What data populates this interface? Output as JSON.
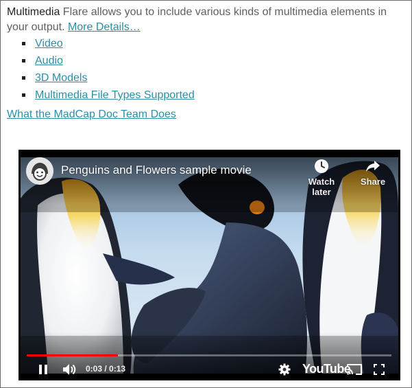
{
  "intro": {
    "term": "Multimedia",
    "text": " Flare allows you to include various kinds of multimedia elements in your output. ",
    "more_link": "More Details…"
  },
  "links": [
    {
      "label": "Video"
    },
    {
      "label": "Audio"
    },
    {
      "label": "3D Models"
    },
    {
      "label": "Multimedia File Types Supported"
    }
  ],
  "team_link": "What the MadCap Doc Team Does",
  "player": {
    "title": "Penguins and Flowers sample movie",
    "watch_later": "Watch later",
    "share": "Share",
    "current_time": "0:03",
    "duration": "0:13",
    "time_separator": " / ",
    "progress_fraction": 0.25,
    "logo_text": "YouTube",
    "accent_color": "#ff0000",
    "icons": [
      "channel-avatar-icon",
      "clock-icon",
      "share-arrow-icon",
      "pause-icon",
      "volume-icon",
      "gear-icon",
      "cast-icon",
      "fullscreen-icon"
    ]
  },
  "colors": {
    "link": "#2a8fa6",
    "body_text": "#5f5f5f"
  }
}
